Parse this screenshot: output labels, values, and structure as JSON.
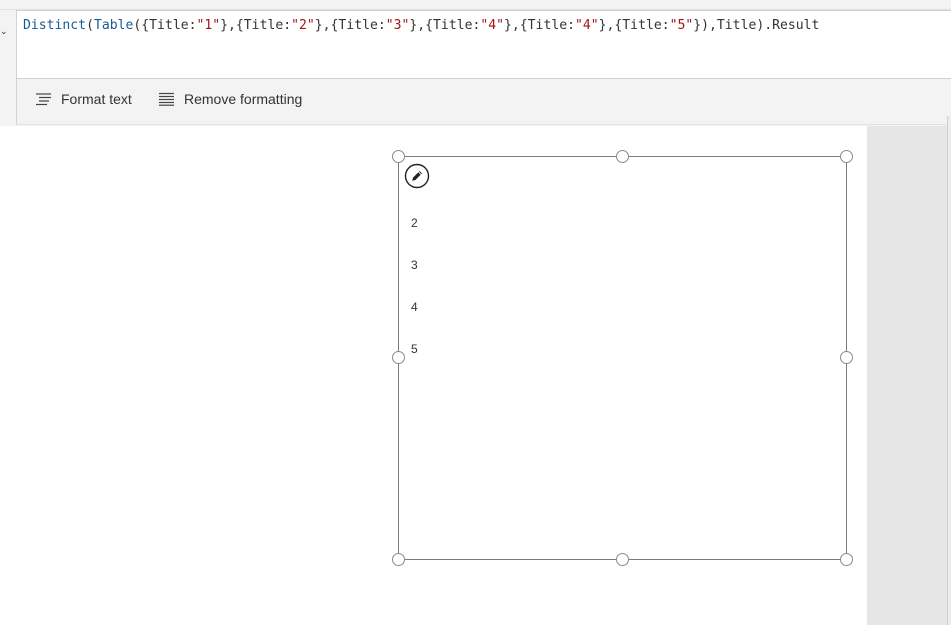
{
  "formula_bar": {
    "caret_icon": "chevron-down-icon",
    "tokens": [
      {
        "t": "Distinct",
        "c": "fn"
      },
      {
        "t": "(",
        "c": "punc"
      },
      {
        "t": "Table",
        "c": "fn"
      },
      {
        "t": "({",
        "c": "punc"
      },
      {
        "t": "Title",
        "c": "field"
      },
      {
        "t": ":",
        "c": "punc"
      },
      {
        "t": "\"1\"",
        "c": "str"
      },
      {
        "t": "},{",
        "c": "punc"
      },
      {
        "t": "Title",
        "c": "field"
      },
      {
        "t": ":",
        "c": "punc"
      },
      {
        "t": "\"2\"",
        "c": "str"
      },
      {
        "t": "},{",
        "c": "punc"
      },
      {
        "t": "Title",
        "c": "field"
      },
      {
        "t": ":",
        "c": "punc"
      },
      {
        "t": "\"3\"",
        "c": "str"
      },
      {
        "t": "},{",
        "c": "punc"
      },
      {
        "t": "Title",
        "c": "field"
      },
      {
        "t": ":",
        "c": "punc"
      },
      {
        "t": "\"4\"",
        "c": "str"
      },
      {
        "t": "},{",
        "c": "punc"
      },
      {
        "t": "Title",
        "c": "field"
      },
      {
        "t": ":",
        "c": "punc"
      },
      {
        "t": "\"4\"",
        "c": "str"
      },
      {
        "t": "},{",
        "c": "punc"
      },
      {
        "t": "Title",
        "c": "field"
      },
      {
        "t": ":",
        "c": "punc"
      },
      {
        "t": "\"5\"",
        "c": "str"
      },
      {
        "t": "}),Title).Result",
        "c": "punc"
      }
    ]
  },
  "toolbar": {
    "format_text_label": "Format text",
    "format_text_icon": "format-text-icon",
    "remove_formatting_label": "Remove formatting",
    "remove_formatting_icon": "remove-formatting-icon"
  },
  "gallery": {
    "edit_icon": "pencil-icon",
    "items": [
      "2",
      "3",
      "4",
      "5"
    ]
  },
  "colors": {
    "function": "#1a5a96",
    "string": "#a31515",
    "text": "#333333"
  }
}
